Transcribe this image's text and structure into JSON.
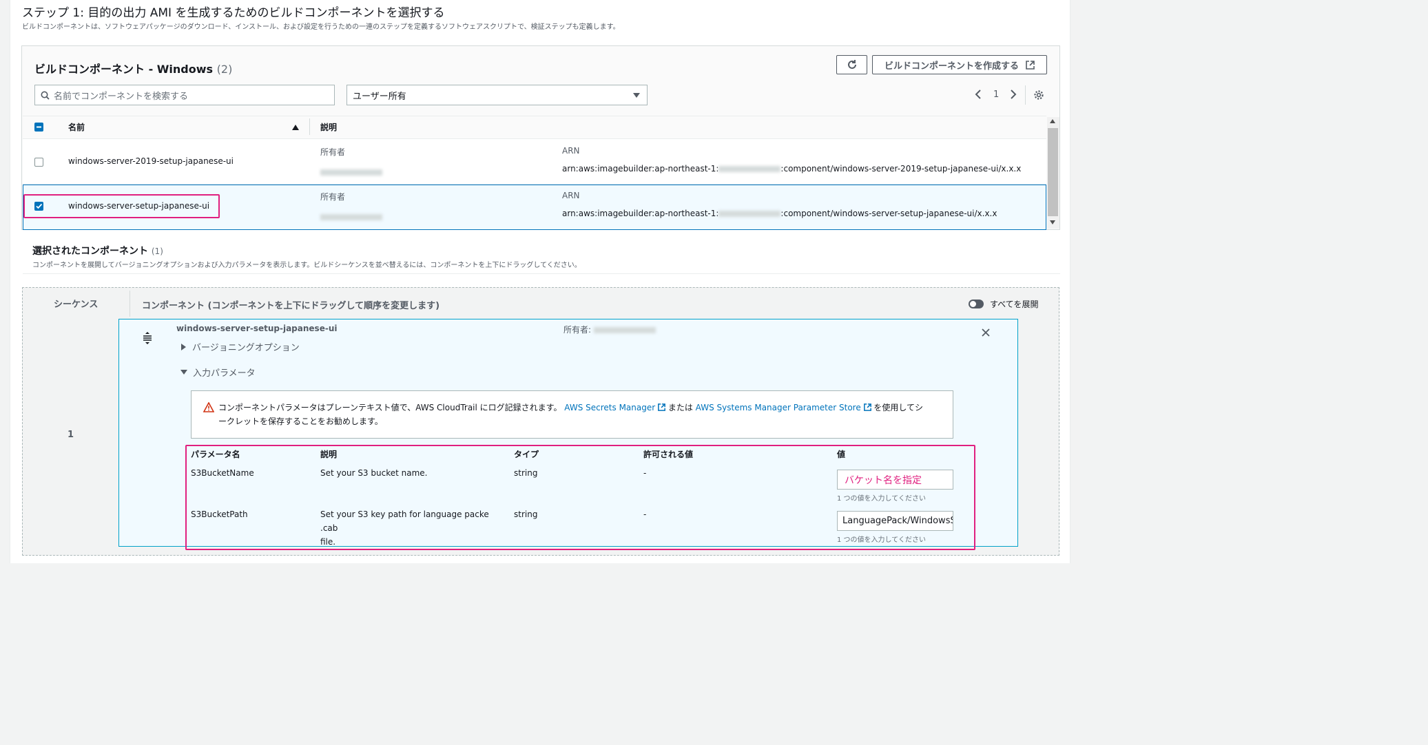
{
  "step": {
    "title": "ステップ 1: 目的の出力 AMI を生成するためのビルドコンポーネントを選択する",
    "description": "ビルドコンポーネントは、ソフトウェアパッケージのダウンロード、インストール、および設定を行うための一連のステップを定義するソフトウェアスクリプトで、検証ステップも定義します。"
  },
  "list": {
    "title": "ビルドコンポーネント - Windows",
    "count": "(2)",
    "create_button": "ビルドコンポーネントを作成する",
    "search_placeholder": "名前でコンポーネントを検索する",
    "filter_value": "ユーザー所有",
    "page": "1",
    "columns": {
      "name": "名前",
      "description": "説明"
    },
    "rows": [
      {
        "name": "windows-server-2019-setup-japanese-ui",
        "owner_label": "所有者",
        "arn_label": "ARN",
        "arn_prefix": "arn:aws:imagebuilder:ap-northeast-1:",
        "arn_suffix": ":component/windows-server-2019-setup-japanese-ui/x.x.x",
        "checked": false
      },
      {
        "name": "windows-server-setup-japanese-ui",
        "owner_label": "所有者",
        "arn_label": "ARN",
        "arn_prefix": "arn:aws:imagebuilder:ap-northeast-1:",
        "arn_suffix": ":component/windows-server-setup-japanese-ui/x.x.x",
        "checked": true
      }
    ]
  },
  "selected": {
    "title": "選択されたコンポーネント",
    "count": "(1)",
    "description": "コンポーネントを展開してバージョニングオプションおよび入力パラメータを表示します。ビルドシーケンスを並べ替えるには、コンポーネントを上下にドラッグしてください。",
    "sequence_header": "シーケンス",
    "component_header": "コンポーネント (コンポーネントを上下にドラッグして順序を変更します)",
    "expand_all": "すべてを展開",
    "sequence_number": "1",
    "component": {
      "name": "windows-server-setup-japanese-ui",
      "owner_label": "所有者:",
      "versioning": "バージョニングオプション",
      "input_params": "入力パラメータ",
      "alert": {
        "text_before": "コンポーネントパラメータはプレーンテキスト値で、AWS CloudTrail にログ記録されます。",
        "link1": "AWS Secrets Manager",
        "between": "または",
        "link2": "AWS Systems Manager Parameter Store",
        "text_after_line1": "を使用してシ",
        "text_line2": "ークレットを保存することをお勧めします。"
      },
      "param_columns": {
        "name": "パラメータ名",
        "description": "説明",
        "type": "タイプ",
        "allowed": "許可される値",
        "value": "値"
      },
      "params": [
        {
          "name": "S3BucketName",
          "description": "Set your S3 bucket name.",
          "description_line2": "",
          "type": "string",
          "allowed": "-",
          "value": "バケット名を指定",
          "hint": "1 つの値を入力してください"
        },
        {
          "name": "S3BucketPath",
          "description": "Set your S3 key path for language packe .cab",
          "description_line2": "file.",
          "type": "string",
          "allowed": "-",
          "value": "LanguagePack/WindowsServer",
          "hint": "1 つの値を入力してください"
        }
      ]
    }
  },
  "colors": {
    "accent": "#0073bb",
    "highlight": "#e01f7f",
    "warning": "#d13212"
  }
}
